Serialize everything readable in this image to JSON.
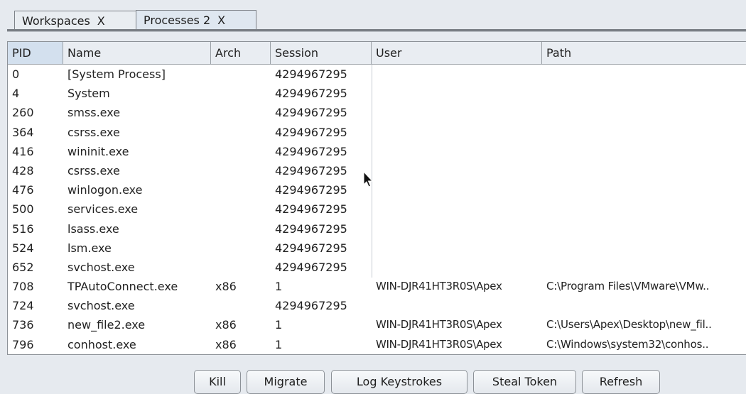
{
  "tabs": [
    {
      "label": "Workspaces",
      "close": "X"
    },
    {
      "label": "Processes 2",
      "close": "X"
    }
  ],
  "table": {
    "columns": [
      "PID",
      "Name",
      "Arch",
      "Session",
      "User",
      "Path"
    ],
    "rows": [
      {
        "pid": "0",
        "name": "[System Process]",
        "arch": "",
        "session": "4294967295",
        "user": "",
        "path": ""
      },
      {
        "pid": "4",
        "name": "System",
        "arch": "",
        "session": "4294967295",
        "user": "",
        "path": ""
      },
      {
        "pid": "260",
        "name": "smss.exe",
        "arch": "",
        "session": "4294967295",
        "user": "",
        "path": ""
      },
      {
        "pid": "364",
        "name": "csrss.exe",
        "arch": "",
        "session": "4294967295",
        "user": "",
        "path": ""
      },
      {
        "pid": "416",
        "name": "wininit.exe",
        "arch": "",
        "session": "4294967295",
        "user": "",
        "path": ""
      },
      {
        "pid": "428",
        "name": "csrss.exe",
        "arch": "",
        "session": "4294967295",
        "user": "",
        "path": ""
      },
      {
        "pid": "476",
        "name": "winlogon.exe",
        "arch": "",
        "session": "4294967295",
        "user": "",
        "path": ""
      },
      {
        "pid": "500",
        "name": "services.exe",
        "arch": "",
        "session": "4294967295",
        "user": "",
        "path": ""
      },
      {
        "pid": "516",
        "name": "lsass.exe",
        "arch": "",
        "session": "4294967295",
        "user": "",
        "path": ""
      },
      {
        "pid": "524",
        "name": "lsm.exe",
        "arch": "",
        "session": "4294967295",
        "user": "",
        "path": ""
      },
      {
        "pid": "652",
        "name": "svchost.exe",
        "arch": "",
        "session": "4294967295",
        "user": "",
        "path": ""
      },
      {
        "pid": "708",
        "name": "TPAutoConnect.exe",
        "arch": "x86",
        "session": "1",
        "user": "WIN-DJR41HT3R0S\\Apex",
        "path": "C:\\Program Files\\VMware\\VMw.."
      },
      {
        "pid": "724",
        "name": "svchost.exe",
        "arch": "",
        "session": "4294967295",
        "user": "",
        "path": ""
      },
      {
        "pid": "736",
        "name": "new_file2.exe",
        "arch": "x86",
        "session": "1",
        "user": "WIN-DJR41HT3R0S\\Apex",
        "path": "C:\\Users\\Apex\\Desktop\\new_fil.."
      },
      {
        "pid": "796",
        "name": "conhost.exe",
        "arch": "x86",
        "session": "1",
        "user": "WIN-DJR41HT3R0S\\Apex",
        "path": "C:\\Windows\\system32\\conhos.."
      }
    ]
  },
  "buttons": {
    "kill": "Kill",
    "migrate": "Migrate",
    "log_keystrokes": "Log Keystrokes",
    "steal_token": "Steal Token",
    "refresh": "Refresh"
  }
}
